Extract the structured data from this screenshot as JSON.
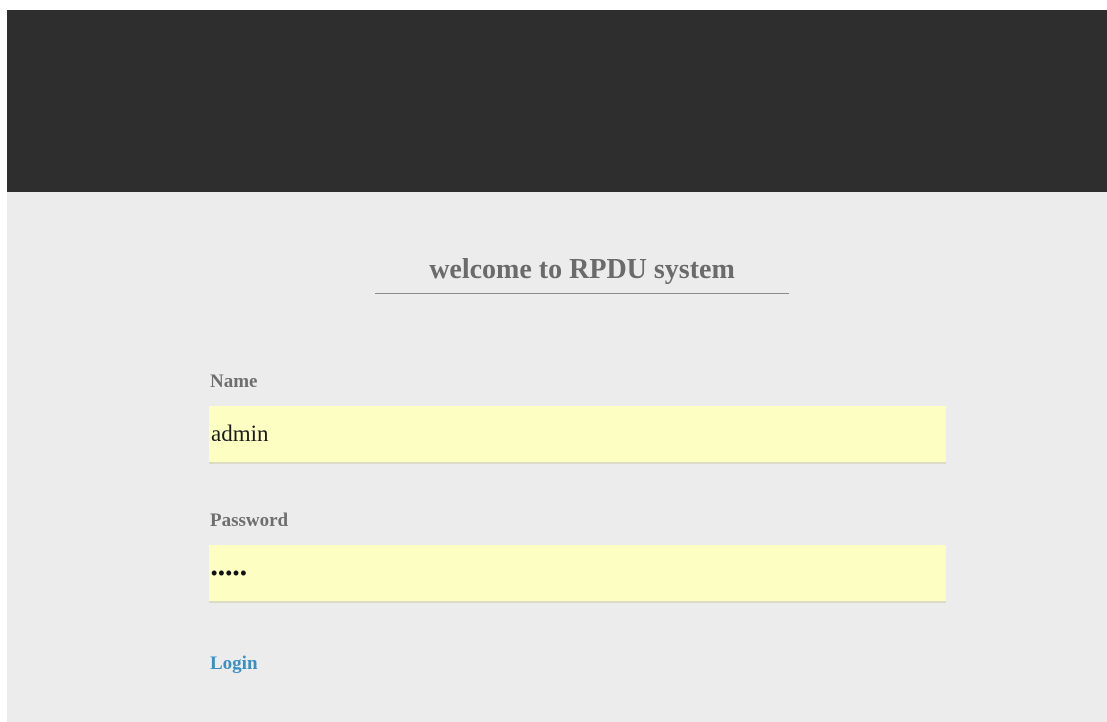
{
  "page": {
    "welcome_title": "welcome to RPDU system"
  },
  "login_form": {
    "name_label": "Name",
    "name_value": "admin",
    "password_label": "Password",
    "password_value": "admin",
    "login_label": "Login"
  },
  "colors": {
    "banner": "#2e2e2e",
    "background": "#ececec",
    "input_fill": "#fdfec1",
    "link": "#3a8fc4",
    "label_text": "#6e6e6e"
  }
}
